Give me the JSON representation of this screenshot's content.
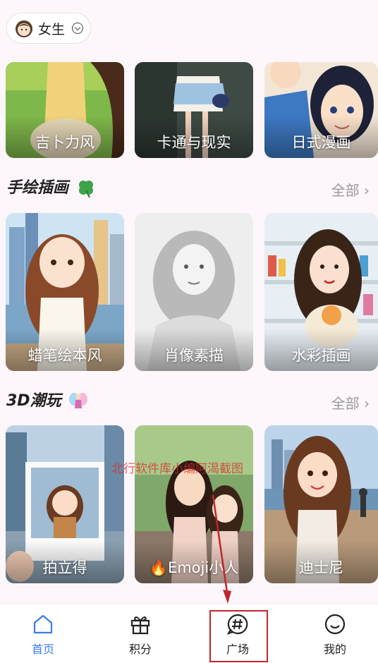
{
  "header": {
    "gender_label": "女生"
  },
  "top_row": [
    {
      "label": "吉卜力风"
    },
    {
      "label": "卡通与现实"
    },
    {
      "label": "日式漫画"
    }
  ],
  "section_handdrawn": {
    "title": "手绘插画",
    "see_all": "全部",
    "items": [
      {
        "label": "蜡笔绘本风"
      },
      {
        "label": "肖像素描"
      },
      {
        "label": "水彩插画"
      }
    ]
  },
  "section_3d": {
    "title": "3D潮玩",
    "see_all": "全部",
    "items": [
      {
        "label": "拍立得"
      },
      {
        "label": "🔥Emoji小人"
      },
      {
        "label": "迪士尼"
      }
    ]
  },
  "watermark": "北行软件库小编阿渴截图",
  "tabbar": {
    "tabs": [
      {
        "label": "首页",
        "icon": "home-icon"
      },
      {
        "label": "积分",
        "icon": "gift-icon"
      },
      {
        "label": "广场",
        "icon": "hash-chat-icon"
      },
      {
        "label": "我的",
        "icon": "smile-icon"
      }
    ]
  },
  "colors": {
    "accent": "#3b7cf0",
    "highlight": "#c0262d",
    "background": "#fdf6fb"
  }
}
